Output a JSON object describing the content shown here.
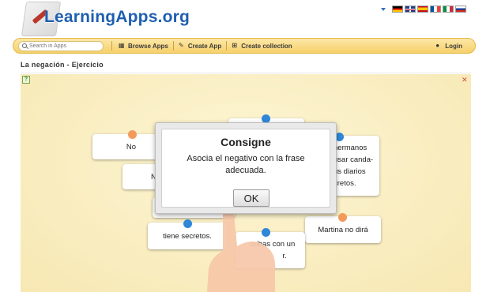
{
  "header": {
    "logo_text": "LearningApps.org",
    "flags": [
      "de",
      "en",
      "es",
      "fr",
      "it",
      "ru"
    ]
  },
  "navbar": {
    "search_placeholder": "Search in Apps",
    "browse_label": "Browse Apps",
    "create_label": "Create App",
    "collection_label": "Create collection",
    "login_label": "Login"
  },
  "page_title": "La negación - Ejercicio",
  "app": {
    "cards": [
      {
        "text": "No"
      },
      {
        "text": "N"
      },
      {
        "text": "hermanos"
      },
      {
        "text": "usar canda-"
      },
      {
        "text": "us diarios"
      },
      {
        "text": "cretos."
      },
      {
        "text": "tiene secretos."
      },
      {
        "text": "Martina no dirá"
      },
      {
        "text": "cribas con un"
      },
      {
        "text": "r."
      }
    ]
  },
  "modal": {
    "title": "Consigne",
    "text": "Asocia el negativo con la frase adecuada.",
    "ok_label": "OK"
  },
  "colors": {
    "brand_blue": "#1f5fb0",
    "navbar_yellow": "#f6d06a",
    "dot_blue": "#2f87d8",
    "dot_orange": "#f39a5a"
  }
}
